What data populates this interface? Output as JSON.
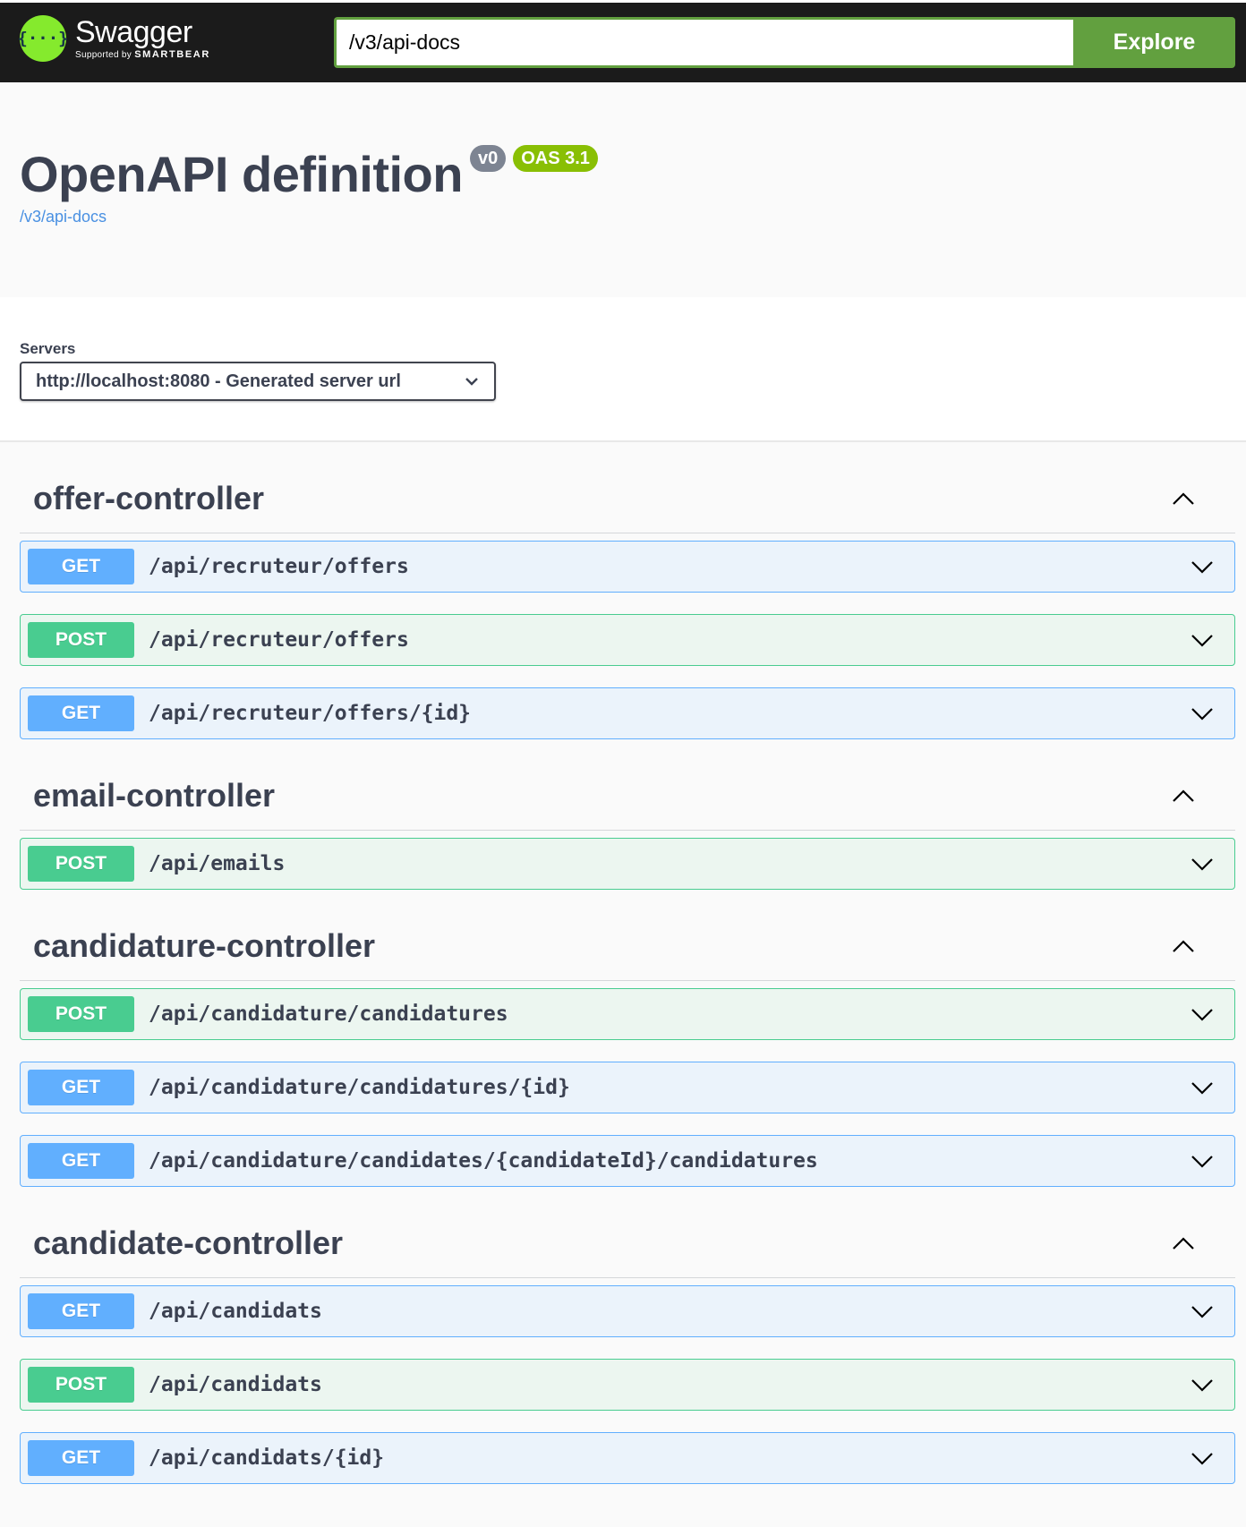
{
  "header": {
    "brand": "Swagger",
    "brand_sub_prefix": "Supported by",
    "brand_sub_company": "SMARTBEAR",
    "logo_glyph": "{···}",
    "url_value": "/v3/api-docs",
    "explore_label": "Explore"
  },
  "info": {
    "title": "OpenAPI definition",
    "version_badge": "v0",
    "oas_badge": "OAS 3.1",
    "spec_link": "/v3/api-docs"
  },
  "servers": {
    "label": "Servers",
    "selected": "http://localhost:8080 - Generated server url"
  },
  "colors": {
    "get": "#61affe",
    "post": "#49cc90",
    "explore": "#62a03f",
    "logo": "#85ea2d",
    "oas_badge": "#89bf04"
  },
  "tags": [
    {
      "name": "offer-controller",
      "operations": [
        {
          "method": "GET",
          "path": "/api/recruteur/offers"
        },
        {
          "method": "POST",
          "path": "/api/recruteur/offers"
        },
        {
          "method": "GET",
          "path": "/api/recruteur/offers/{id}"
        }
      ]
    },
    {
      "name": "email-controller",
      "operations": [
        {
          "method": "POST",
          "path": "/api/emails"
        }
      ]
    },
    {
      "name": "candidature-controller",
      "operations": [
        {
          "method": "POST",
          "path": "/api/candidature/candidatures"
        },
        {
          "method": "GET",
          "path": "/api/candidature/candidatures/{id}"
        },
        {
          "method": "GET",
          "path": "/api/candidature/candidates/{candidateId}/candidatures"
        }
      ]
    },
    {
      "name": "candidate-controller",
      "operations": [
        {
          "method": "GET",
          "path": "/api/candidats"
        },
        {
          "method": "POST",
          "path": "/api/candidats"
        },
        {
          "method": "GET",
          "path": "/api/candidats/{id}"
        }
      ]
    }
  ]
}
